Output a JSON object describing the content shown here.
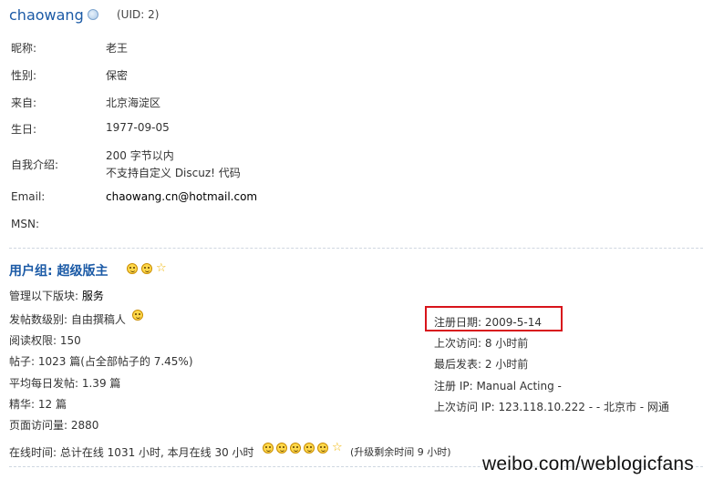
{
  "profile": {
    "username": "chaowang",
    "uid": "(UID: 2)"
  },
  "fields": [
    {
      "label": "昵称:",
      "value": "老王"
    },
    {
      "label": "性别:",
      "value": "保密"
    },
    {
      "label": "来自:",
      "value": "北京海淀区"
    },
    {
      "label": "生日:",
      "value": "1977-09-05"
    },
    {
      "label": "自我介绍:",
      "value_line1": "200 字节以内",
      "value_line2": "不支持自定义 Discuz! 代码"
    },
    {
      "label": "Email:",
      "value": "chaowang.cn@hotmail.com"
    },
    {
      "label": "MSN:",
      "value": ""
    }
  ],
  "group": {
    "title": "用户组: 超级版主",
    "manage_prefix": "管理以下版块:",
    "manage_value": "服务",
    "post_level": "发帖数级别: 自由撰稿人",
    "read_level": "阅读权限: 150",
    "posts": "帖子: 1023 篇(占全部帖子的 7.45%)",
    "daily_posts": "平均每日发帖: 1.39 篇",
    "digest": "精华: 12 篇",
    "page_views": "页面访问量: 2880"
  },
  "right_stats": {
    "reg_date": "注册日期: 2009-5-14",
    "last_visit": "上次访问: 8 小时前",
    "last_post": "最后发表: 2 小时前",
    "reg_ip": "注册 IP: Manual Acting -",
    "last_visit_ip": "上次访问 IP: 123.118.10.222 - - 北京市 - 网通"
  },
  "online": {
    "text": "在线时间: 总计在线 1031 小时, 本月在线 30 小时",
    "upgrade": "(升级剩余时间 9 小时)"
  },
  "watermark": "weibo.com/weblogicfans",
  "colors": {
    "link_blue": "#1b5aa6",
    "highlight_red": "#d8141b",
    "smiley_yellow": "#ffd84a"
  },
  "icons": {
    "status": "online-status-icon",
    "smiley": "smiley-icon",
    "star": "star-icon"
  }
}
